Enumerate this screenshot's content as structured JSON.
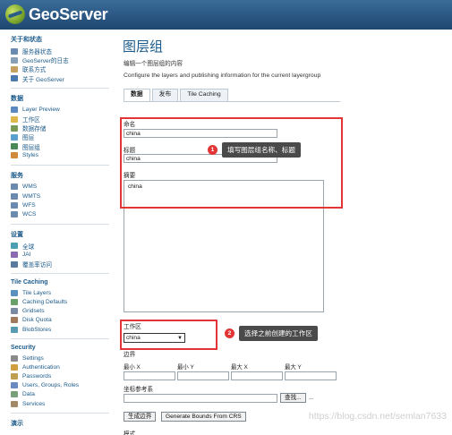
{
  "app": {
    "name": "GeoServer"
  },
  "colors": {
    "header": "#2a5c88",
    "link": "#1b5a8a",
    "annotation": "#e23636"
  },
  "sidebar": {
    "sections": [
      {
        "title": "关于和状态",
        "items": [
          {
            "label": "服务器状态",
            "icon": "server-status-icon"
          },
          {
            "label": "GeoServer的日志",
            "icon": "log-icon"
          },
          {
            "label": "联系方式",
            "icon": "contact-icon"
          },
          {
            "label": "关于 GeoServer",
            "icon": "info-icon"
          }
        ]
      },
      {
        "title": "数据",
        "items": [
          {
            "label": "Layer Preview",
            "icon": "layer-preview-icon"
          },
          {
            "label": "工作区",
            "icon": "folder-icon"
          },
          {
            "label": "数据存储",
            "icon": "store-icon"
          },
          {
            "label": "图层",
            "icon": "layer-icon"
          },
          {
            "label": "图层组",
            "icon": "layer-group-icon"
          },
          {
            "label": "Styles",
            "icon": "style-icon"
          }
        ]
      },
      {
        "title": "服务",
        "items": [
          {
            "label": "WMS",
            "icon": "service-icon"
          },
          {
            "label": "WMTS",
            "icon": "service-icon"
          },
          {
            "label": "WFS",
            "icon": "service-icon"
          },
          {
            "label": "WCS",
            "icon": "service-icon"
          }
        ]
      },
      {
        "title": "设置",
        "items": [
          {
            "label": "全球",
            "icon": "globe-icon"
          },
          {
            "label": "JAI",
            "icon": "jai-icon"
          },
          {
            "label": "覆盖率访问",
            "icon": "coverage-icon"
          }
        ]
      },
      {
        "title": "Tile Caching",
        "items": [
          {
            "label": "Tile Layers",
            "icon": "tile-layers-icon"
          },
          {
            "label": "Caching Defaults",
            "icon": "caching-defaults-icon"
          },
          {
            "label": "Gridsets",
            "icon": "gridsets-icon"
          },
          {
            "label": "Disk Quota",
            "icon": "disk-quota-icon"
          },
          {
            "label": "BlobStores",
            "icon": "blobstores-icon"
          }
        ]
      },
      {
        "title": "Security",
        "items": [
          {
            "label": "Settings",
            "icon": "settings-icon"
          },
          {
            "label": "Authentication",
            "icon": "authentication-icon"
          },
          {
            "label": "Passwords",
            "icon": "passwords-icon"
          },
          {
            "label": "Users, Groups, Roles",
            "icon": "users-icon"
          },
          {
            "label": "Data",
            "icon": "data-security-icon"
          },
          {
            "label": "Services",
            "icon": "services-security-icon"
          }
        ]
      },
      {
        "title": "演示",
        "items": []
      }
    ]
  },
  "main": {
    "title": "图层组",
    "description_cn": "编辑一个图层组的内容",
    "description_en": "Configure the layers and publishing information for the current layergroup",
    "tabs": [
      {
        "label": "数据"
      },
      {
        "label": "发布"
      },
      {
        "label": "Tile Caching"
      }
    ],
    "form": {
      "name_label": "命名",
      "name_value": "china",
      "title_label": "标题",
      "title_value": "china",
      "abstract_label": "摘要",
      "abstract_value": "china",
      "workspace_label": "工作区",
      "workspace_value": "china",
      "bounds_label": "边界",
      "minx_label": "最小 X",
      "miny_label": "最小 Y",
      "maxx_label": "最大 X",
      "maxy_label": "最大 Y",
      "crs_label": "坐标参考系",
      "find_button": "查找...",
      "crs_ellipsis": "...",
      "generate_bounds_button": "生成边界",
      "generate_from_crs_button": "Generate Bounds From CRS",
      "mode_label": "模式"
    }
  },
  "annotations": {
    "callout1": {
      "number": "1",
      "text": "填写图层组名称、标题"
    },
    "callout2": {
      "number": "2",
      "text": "选择之前创建的工作区"
    }
  },
  "watermark": "https://blog.csdn.net/semlan7633"
}
